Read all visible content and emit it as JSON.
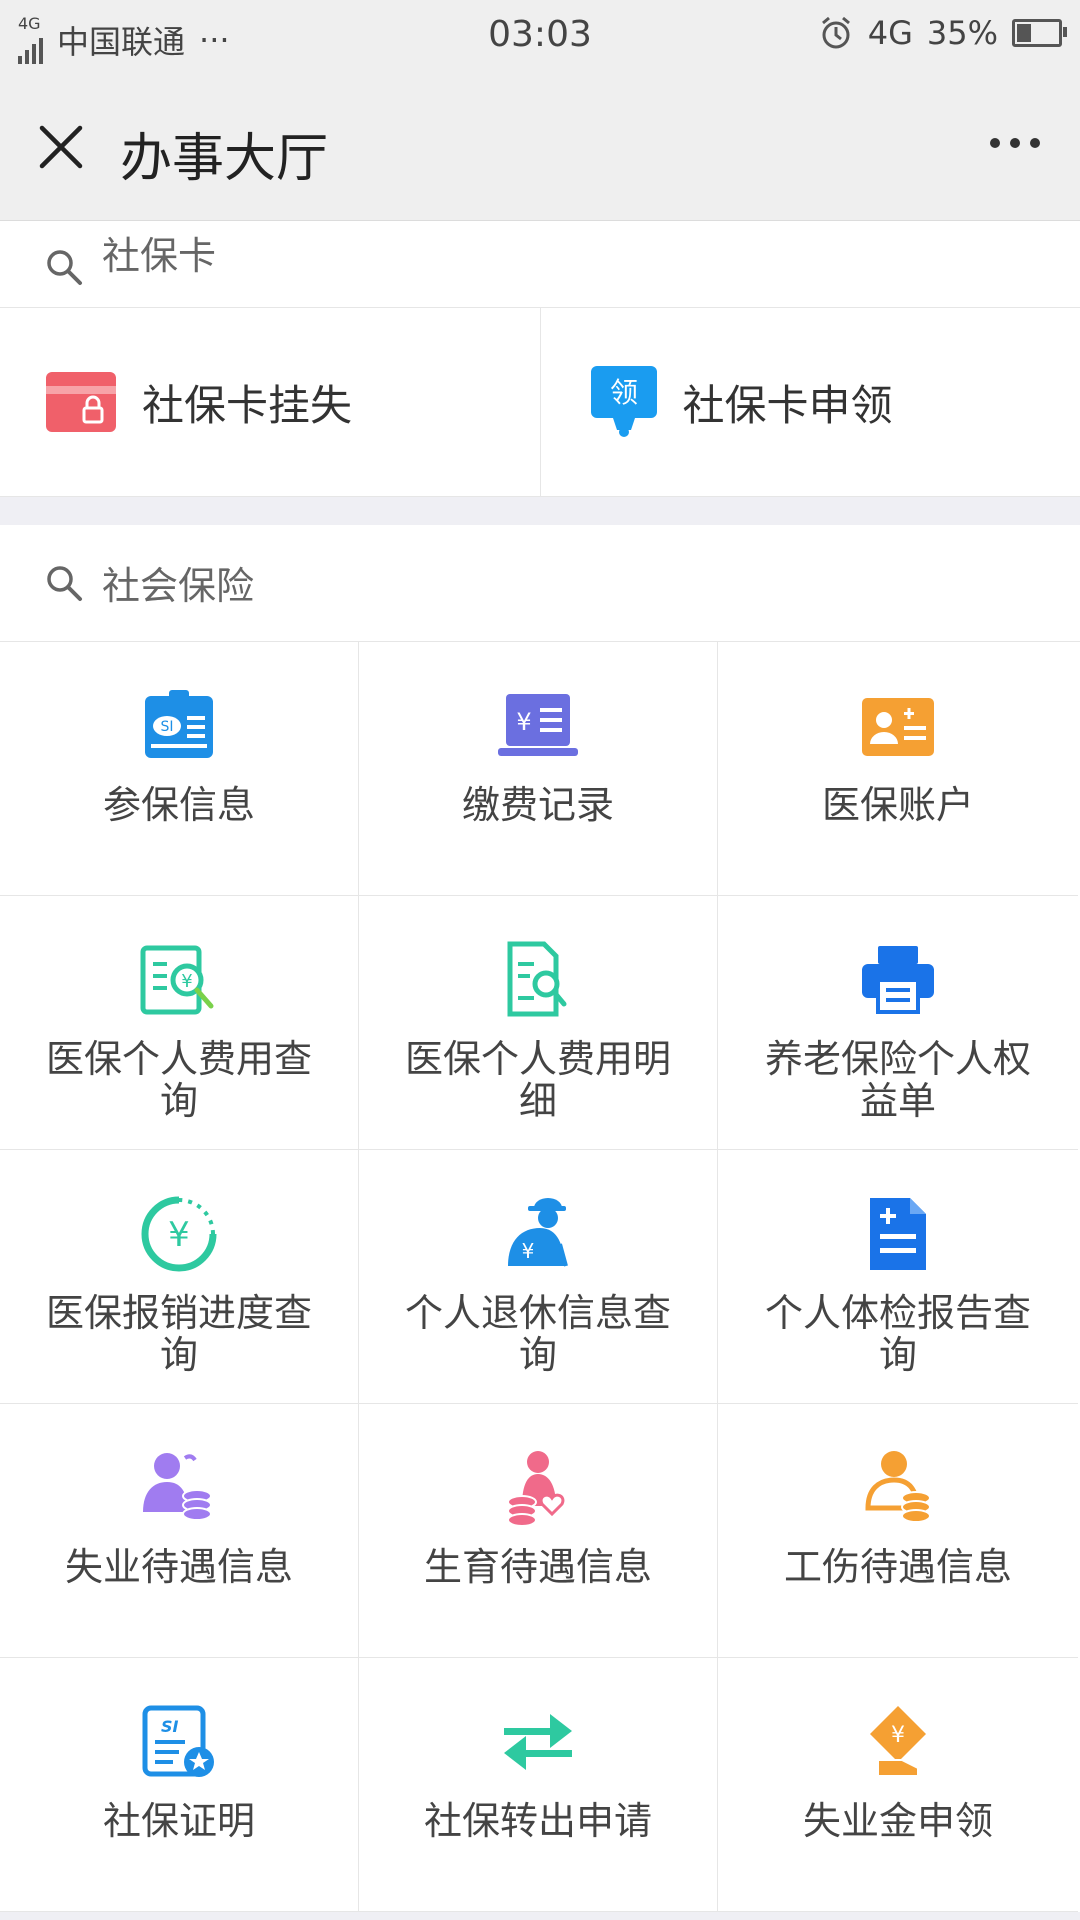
{
  "status_bar": {
    "network": "4G",
    "carrier": "中国联通",
    "carrier_dots": "···",
    "time": "03:03",
    "network_type": "4G",
    "battery": "35%",
    "battery_level": 0.35
  },
  "nav": {
    "title": "办事大厅",
    "close_icon": "close-icon",
    "more_icon": "more-icon"
  },
  "social_card": {
    "search_label": "社保卡",
    "items": [
      {
        "label": "社保卡挂失",
        "icon": "card-lock-icon",
        "color": "#f0606a"
      },
      {
        "label": "社保卡申领",
        "icon": "apply-badge-icon",
        "badge": "领",
        "color": "#1a9cf0"
      }
    ]
  },
  "social_insurance": {
    "search_label": "社会保险",
    "items": [
      {
        "label": "参保信息",
        "icon": "id-card-icon",
        "color": "#1e8fe6"
      },
      {
        "label": "缴费记录",
        "icon": "laptop-yuan-icon",
        "color": "#6b6fe0"
      },
      {
        "label": "医保账户",
        "icon": "account-card-icon",
        "color": "#f5a033"
      },
      {
        "label": "医保个人费用查询",
        "icon": "fee-search-icon",
        "color": "#2ec9a0"
      },
      {
        "label": "医保个人费用明细",
        "icon": "doc-search-icon",
        "color": "#2ec9a0"
      },
      {
        "label": "养老保险个人权益单",
        "icon": "printer-icon",
        "color": "#1a73e8"
      },
      {
        "label": "医保报销进度查询",
        "icon": "yuan-progress-icon",
        "color": "#2ec9a0"
      },
      {
        "label": "个人退休信息查询",
        "icon": "retiree-icon",
        "color": "#1e8fe6"
      },
      {
        "label": "个人体检报告查询",
        "icon": "medical-report-icon",
        "color": "#1a73e8"
      },
      {
        "label": "失业待遇信息",
        "icon": "person-coins-icon",
        "color": "#a07cf0"
      },
      {
        "label": "生育待遇信息",
        "icon": "maternity-icon",
        "color": "#f06a8a"
      },
      {
        "label": "工伤待遇信息",
        "icon": "injury-icon",
        "color": "#f5a033"
      },
      {
        "label": "社保证明",
        "icon": "si-certificate-icon",
        "color": "#1e8fe6"
      },
      {
        "label": "社保转出申请",
        "icon": "transfer-arrows-icon",
        "color": "#2ec9a0"
      },
      {
        "label": "失业金申领",
        "icon": "benefit-claim-icon",
        "color": "#f5a033"
      }
    ]
  }
}
